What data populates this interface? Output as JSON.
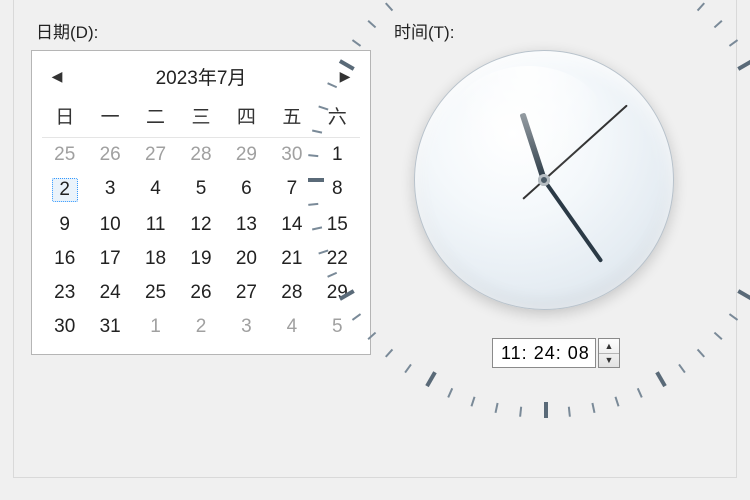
{
  "labels": {
    "date": "日期(D):",
    "time": "时间(T):"
  },
  "calendar": {
    "title": "2023年7月",
    "prev_icon": "◀",
    "next_icon": "▶",
    "dow": [
      "日",
      "一",
      "二",
      "三",
      "四",
      "五",
      "六"
    ],
    "selected_day": 2,
    "weeks": [
      [
        {
          "n": 25,
          "other": true
        },
        {
          "n": 26,
          "other": true
        },
        {
          "n": 27,
          "other": true
        },
        {
          "n": 28,
          "other": true
        },
        {
          "n": 29,
          "other": true
        },
        {
          "n": 30,
          "other": true
        },
        {
          "n": 1
        }
      ],
      [
        {
          "n": 2,
          "selected": true
        },
        {
          "n": 3
        },
        {
          "n": 4
        },
        {
          "n": 5
        },
        {
          "n": 6
        },
        {
          "n": 7
        },
        {
          "n": 8
        }
      ],
      [
        {
          "n": 9
        },
        {
          "n": 10
        },
        {
          "n": 11
        },
        {
          "n": 12
        },
        {
          "n": 13
        },
        {
          "n": 14
        },
        {
          "n": 15
        }
      ],
      [
        {
          "n": 16
        },
        {
          "n": 17
        },
        {
          "n": 18
        },
        {
          "n": 19
        },
        {
          "n": 20
        },
        {
          "n": 21
        },
        {
          "n": 22
        }
      ],
      [
        {
          "n": 23
        },
        {
          "n": 24
        },
        {
          "n": 25
        },
        {
          "n": 26
        },
        {
          "n": 27
        },
        {
          "n": 28
        },
        {
          "n": 29
        }
      ],
      [
        {
          "n": 30
        },
        {
          "n": 31
        },
        {
          "n": 1,
          "other": true
        },
        {
          "n": 2,
          "other": true
        },
        {
          "n": 3,
          "other": true
        },
        {
          "n": 4,
          "other": true
        },
        {
          "n": 5,
          "other": true
        }
      ]
    ]
  },
  "clock": {
    "hours": 11,
    "minutes": 24,
    "seconds": 8
  },
  "time_input": {
    "value": "11: 24: 08"
  },
  "spinner": {
    "up": "▲",
    "down": "▼"
  }
}
